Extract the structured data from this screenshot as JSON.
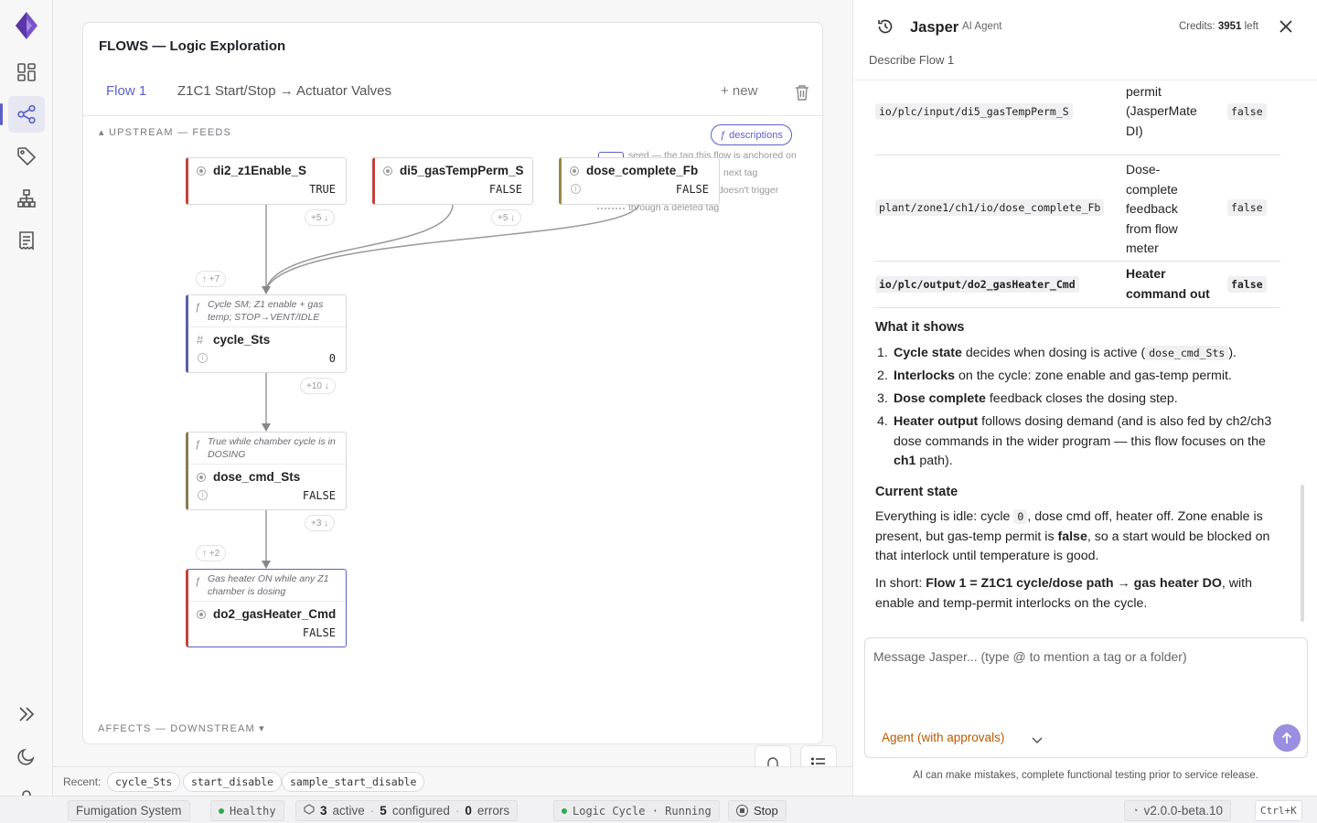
{
  "rail": {
    "items": [
      "dashboard-icon",
      "flows-icon",
      "tags-icon",
      "hierarchy-icon",
      "report-icon"
    ],
    "bottom": [
      "expand-icon",
      "dark-mode-icon",
      "user-icon"
    ]
  },
  "canvas": {
    "title": "FLOWS — Logic Exploration",
    "tab_active": "Flow 1",
    "tab_name": "Z1C1 Start/Stop → Actuator Valves",
    "new_label": "+ new",
    "upstream_label": "▴ UPSTREAM — FEEDS",
    "downstream_label": "AFFECTS — DOWNSTREAM ▾",
    "descriptions_label": "descriptions",
    "note_lines": [
      "seed — the tag this flow is anchored on",
      "next tag",
      "doesn't trigger",
      "through a deleted tag"
    ],
    "nodes": [
      {
        "name": "di2_z1Enable_S",
        "value": "TRUE",
        "chip": "+5 ↓"
      },
      {
        "name": "di5_gasTempPerm_S",
        "value": "FALSE",
        "chip": "+5 ↓"
      },
      {
        "name": "dose_complete_Fb",
        "value": "FALSE"
      },
      {
        "name": "cycle_Sts",
        "value": "0",
        "desc": "Cycle SM; Z1 enable + gas temp; STOP→VENT/IDLE",
        "chip_up": "↑ +7",
        "chip": "+10 ↓"
      },
      {
        "name": "dose_cmd_Sts",
        "value": "FALSE",
        "desc": "True while chamber cycle is in DOSING",
        "chip": "+3 ↓"
      },
      {
        "name": "do2_gasHeater_Cmd",
        "value": "FALSE",
        "desc": "Gas heater ON while any Z1 chamber is dosing",
        "chip_up": "↑ +2"
      }
    ]
  },
  "recent": {
    "label": "Recent:",
    "items": [
      "cycle_Sts",
      "start_disable",
      "sample_start_disable"
    ]
  },
  "status": {
    "system": "Fumigation System",
    "health": "Healthy",
    "active_count": "3",
    "active_label": "active",
    "configured_count": "5",
    "configured_label": "configured",
    "error_count": "0",
    "error_label": "errors",
    "logic": "Logic Cycle · Running",
    "stop": "Stop",
    "version": "v2.0.0-beta.10",
    "shortcut": "Ctrl+K"
  },
  "agent": {
    "name": "Jasper",
    "tag": "AI Agent",
    "credits_label": "Credits:",
    "credits_value": "3951",
    "credits_suffix": "left",
    "subtitle": "Describe Flow 1",
    "table_rows": [
      {
        "tag": "io/plc/input/di5_gasTempPerm_S",
        "desc_lines": [
          "temperature",
          "permit",
          "(JasperMate",
          "DI)"
        ],
        "value": "false"
      },
      {
        "tag": "plant/zone1/ch1/io/dose_complete_Fb",
        "desc_lines": [
          "Dose-",
          "complete",
          "feedback",
          "from flow",
          "meter"
        ],
        "value": "false"
      },
      {
        "tag": "io/plc/output/do2_gasHeater_Cmd",
        "desc_lines": [
          "Heater",
          "command out"
        ],
        "value": "false"
      }
    ],
    "what_heading": "What it shows",
    "list": [
      {
        "n": "1.",
        "bold": "Cycle state",
        "text": " decides when dosing is active (",
        "code": "dose_cmd_Sts",
        "tail": ")."
      },
      {
        "n": "2.",
        "bold": "Interlocks",
        "text": " on the cycle: zone enable and gas-temp permit."
      },
      {
        "n": "3.",
        "bold": "Dose complete",
        "text": " feedback closes the dosing step."
      },
      {
        "n": "4.",
        "bold": "Heater output",
        "text": " follows dosing demand (and is also fed by ch2/ch3 dose commands in the wider program — this flow focuses on the ",
        "bold2": "ch1",
        "tail": " path)."
      }
    ],
    "state_heading": "Current state",
    "state_p1_a": "Everything is idle: cycle ",
    "state_p1_code": "0",
    "state_p1_b": ", dose cmd off, heater off. Zone enable is present, but gas-temp permit is ",
    "state_p1_bold": "false",
    "state_p1_c": ", so a start would be blocked on that interlock until temperature is good.",
    "short_a": "In short: ",
    "short_bold": "Flow 1 = Z1C1 cycle/dose path → gas heater DO",
    "short_b": ", with enable and temp-permit interlocks on the cycle.",
    "composer_placeholder": "Message Jasper... (type @ to mention a tag or a folder)",
    "mode": "Agent (with approvals)",
    "disclaimer": "AI can make mistakes, complete functional testing prior to service release."
  }
}
